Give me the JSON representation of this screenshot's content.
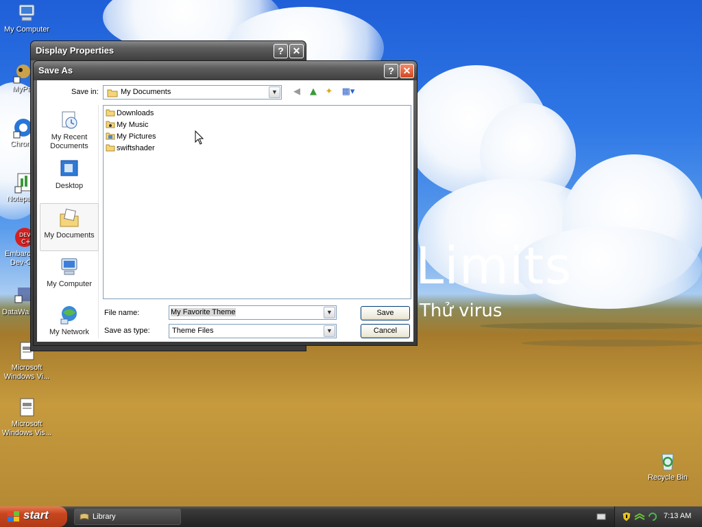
{
  "desktop": {
    "wallpaper_text": {
      "big": "Limits",
      "small": "Thử virus"
    },
    "icons": [
      {
        "label": "My Computer"
      },
      {
        "label": "MyPa"
      },
      {
        "label": "Chrom"
      },
      {
        "label": "Notepa"
      },
      {
        "label": "Embarca",
        "label2": "Dev-C"
      },
      {
        "label": "DataWa"
      },
      {
        "label": "Microsoft",
        "label2": "Windows Vi..."
      },
      {
        "label": "Microsoft",
        "label2": "Windows Vis..."
      },
      {
        "label": "Recycle Bin"
      }
    ]
  },
  "display_properties": {
    "title": "Display Properties",
    "help_button": "?",
    "close_button": "✕"
  },
  "save_as": {
    "title": "Save As",
    "help_button": "?",
    "close_button": "✕",
    "save_in_label": "Save in:",
    "save_in_value": "My Documents",
    "places": [
      {
        "label": "My Recent",
        "label2": "Documents"
      },
      {
        "label": "Desktop"
      },
      {
        "label": "My Documents"
      },
      {
        "label": "My Computer"
      },
      {
        "label": "My Network"
      }
    ],
    "files": [
      "Downloads",
      "My Music",
      "My Pictures",
      "swiftshader"
    ],
    "file_name_label": "File name:",
    "file_name_value": "My Favorite Theme",
    "save_type_label": "Save as type:",
    "save_type_value": "Theme Files",
    "save_button": "Save",
    "cancel_button": "Cancel"
  },
  "taskbar": {
    "start_label": "start",
    "task_label": "Library",
    "clock": "7:13 AM"
  },
  "colors": {
    "title_dark": "#3e3e3e",
    "close_red": "#d2461f",
    "start_orange": "#c9461f",
    "sky_blue": "#2f78e6",
    "field_gold": "#c69a3d"
  }
}
